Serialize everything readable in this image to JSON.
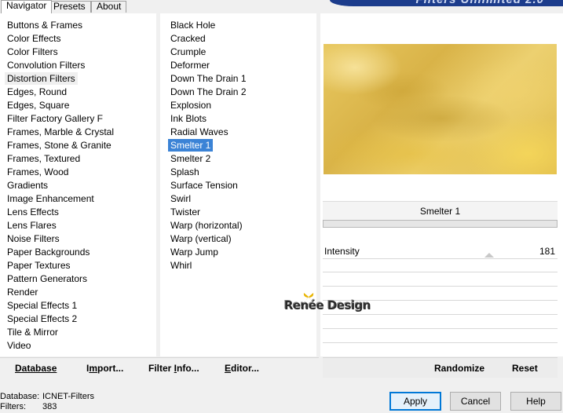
{
  "tabs": [
    {
      "label": "Navigator",
      "active": true
    },
    {
      "label": "Presets",
      "active": false
    },
    {
      "label": "About",
      "active": false
    }
  ],
  "banner_text": "Filters Unlimited 2.0",
  "categories": [
    "Buttons & Frames",
    "Color Effects",
    "Color Filters",
    "Convolution Filters",
    "Distortion Filters",
    "Edges, Round",
    "Edges, Square",
    "Filter Factory Gallery F",
    "Frames, Marble & Crystal",
    "Frames, Stone & Granite",
    "Frames, Textured",
    "Frames, Wood",
    "Gradients",
    "Image Enhancement",
    "Lens Effects",
    "Lens Flares",
    "Noise Filters",
    "Paper Backgrounds",
    "Paper Textures",
    "Pattern Generators",
    "Render",
    "Special Effects 1",
    "Special Effects 2",
    "Tile & Mirror",
    "Video"
  ],
  "hover_category_index": 4,
  "filters": [
    "Black Hole",
    "Cracked",
    "Crumple",
    "Deformer",
    "Down The Drain 1",
    "Down The Drain 2",
    "Explosion",
    "Ink Blots",
    "Radial Waves",
    "Smelter 1",
    "Smelter 2",
    "Splash",
    "Surface Tension",
    "Swirl",
    "Twister",
    "Warp (horizontal)",
    "Warp (vertical)",
    "Warp Jump",
    "Whirl"
  ],
  "selected_filter_index": 9,
  "filter_panel": {
    "title": "Smelter 1",
    "param_label": "Intensity",
    "param_value": "181"
  },
  "watermark": "Renée Design",
  "toolbar": {
    "database": "Database",
    "import_pre": "I",
    "import_ul": "m",
    "import_post": "port...",
    "filter_info_pre": "Filter ",
    "filter_info_ul": "I",
    "filter_info_post": "nfo...",
    "editor_pre": "",
    "editor_ul": "E",
    "editor_post": "ditor...",
    "randomize": "Randomize",
    "reset": "Reset"
  },
  "status": {
    "database_label": "Database:",
    "database_value": "ICNET-Filters",
    "filters_label": "Filters:",
    "filters_value": "383"
  },
  "buttons": {
    "apply": "Apply",
    "cancel": "Cancel",
    "help": "Help"
  }
}
